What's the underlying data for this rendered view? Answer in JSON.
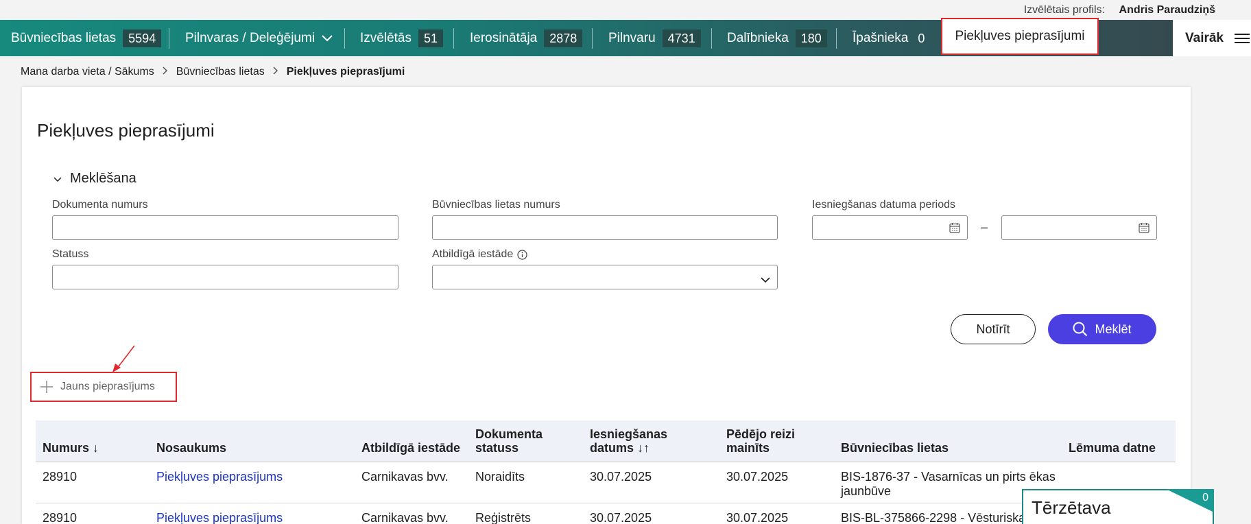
{
  "profile": {
    "label": "Izvēlētais profils:",
    "name": "Andris Paraudziņš"
  },
  "nav": {
    "items": [
      {
        "label": "Būvniecības lietas",
        "count": "5594"
      },
      {
        "label": "Pilnvaras / Deleģējumi",
        "count": ""
      },
      {
        "label": "Izvēlētās",
        "count": "51"
      },
      {
        "label": "Ierosinātāja",
        "count": "2878"
      },
      {
        "label": "Pilnvaru",
        "count": "4731"
      },
      {
        "label": "Dalībnieka",
        "count": "180"
      },
      {
        "label": "Īpašnieka",
        "count": "0"
      }
    ],
    "active": "Piekļuves pieprasījumi",
    "more": "Vairāk"
  },
  "breadcrumb": [
    "Mana darba vieta / Sākums",
    "Būvniecības lietas",
    "Piekļuves pieprasījumi"
  ],
  "page": {
    "title": "Piekļuves pieprasījumi"
  },
  "search": {
    "toggle": "Meklēšana",
    "fields": {
      "doc_number": {
        "label": "Dokumenta numurs",
        "value": ""
      },
      "case_number": {
        "label": "Būvniecības lietas numurs",
        "value": ""
      },
      "date_period": {
        "label": "Iesniegšanas datuma periods",
        "from": "",
        "to": "",
        "dash": "–"
      },
      "status": {
        "label": "Statuss",
        "value": ""
      },
      "institution": {
        "label": "Atbildīgā iestāde",
        "value": ""
      }
    },
    "clear_label": "Notīrīt",
    "search_label": "Meklēt"
  },
  "new_request": "Jauns pieprasījums",
  "table": {
    "columns": [
      "Numurs ↓",
      "Nosaukums",
      "Atbildīgā iestāde",
      "Dokumenta statuss",
      "Iesniegšanas datums ↓↑",
      "Pēdējo reizi mainīts",
      "Būvniecības lietas",
      "Lēmuma datne"
    ],
    "rows": [
      {
        "number": "28910",
        "name": "Piekļuves pieprasījums",
        "institution": "Carnikavas bvv.",
        "status": "Noraidīts",
        "submitted": "30.07.2025",
        "modified": "30.07.2025",
        "case": "BIS-1876-37 - Vasarnīcas un pirts ēkas jaunbūve",
        "decision": ""
      },
      {
        "number": "28910",
        "name": "Piekļuves pieprasījums",
        "institution": "Carnikavas bvv.",
        "status": "Reģistrēts",
        "submitted": "30.07.2025",
        "modified": "30.07.2025",
        "case": "BIS-BL-375866-2298 - Vēsturiska",
        "decision": ""
      }
    ]
  },
  "chat": {
    "title": "Tērzētava",
    "count": "0"
  },
  "colors": {
    "accent": "#4b3fe2",
    "highlight": "#e0282e",
    "link": "#1a33c8",
    "nav": "#17897d"
  }
}
